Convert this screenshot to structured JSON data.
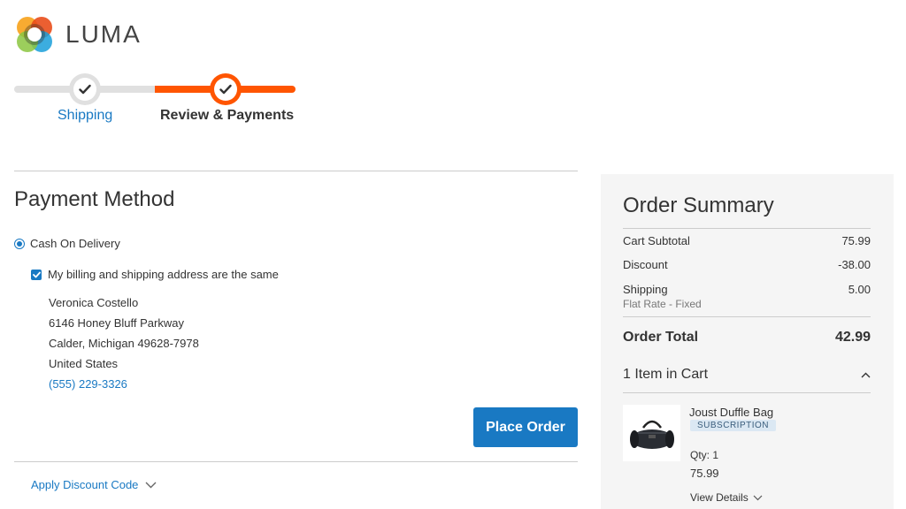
{
  "brand": {
    "logo_text": "LUMA"
  },
  "progress": {
    "steps": [
      {
        "label": "Shipping",
        "state": "complete"
      },
      {
        "label": "Review & Payments",
        "state": "active"
      }
    ],
    "accent_color": "#ff5501"
  },
  "payment": {
    "title": "Payment Method",
    "method_label": "Cash On Delivery",
    "method_selected": true,
    "same_address_label": "My billing and shipping address are the same",
    "same_address_checked": true,
    "address": {
      "name": "Veronica Costello",
      "street": "6146 Honey Bluff Parkway",
      "city_line": "Calder, Michigan 49628-7978",
      "country": "United States",
      "phone": "(555) 229-3326"
    },
    "place_order_label": "Place Order",
    "discount_link_label": "Apply Discount Code"
  },
  "summary": {
    "title": "Order Summary",
    "subtotal_label": "Cart Subtotal",
    "subtotal_value": "75.99",
    "discount_label": "Discount",
    "discount_value": "-38.00",
    "shipping_label": "Shipping",
    "shipping_value": "5.00",
    "shipping_method": "Flat Rate - Fixed",
    "total_label": "Order Total",
    "total_value": "42.99",
    "items_in_cart_label": "1 Item in Cart",
    "item": {
      "name": "Joust Duffle Bag",
      "badge": "SUBSCRIPTION",
      "qty_label": "Qty: 1",
      "price": "75.99",
      "view_details_label": "View Details"
    }
  },
  "colors": {
    "primary_blue": "#1979c3",
    "orange": "#ff5501",
    "summary_bg": "#f5f5f5"
  },
  "icons": {
    "logo": "luma-logo-icon",
    "step_check": "checkmark-icon",
    "collapse": "chevron-up-icon",
    "expand": "chevron-down-icon"
  }
}
